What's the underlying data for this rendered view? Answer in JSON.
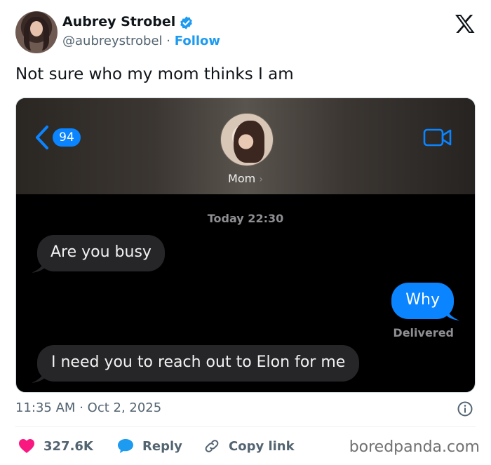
{
  "author": {
    "name": "Aubrey Strobel",
    "handle": "@aubreystrobel",
    "separator": "·",
    "follow_label": "Follow",
    "avatar_icon": "user-avatar",
    "verified_icon": "verified-badge-icon",
    "platform_icon": "x-logo-icon"
  },
  "tweet": {
    "text": "Not sure who my mom thinks I am"
  },
  "screenshot": {
    "back_count": "94",
    "contact_name": "Mom",
    "contact_chevron": "›",
    "timestamp": "Today 22:30",
    "messages": [
      {
        "direction": "incoming",
        "text": "Are you busy"
      },
      {
        "direction": "outgoing",
        "text": "Why"
      },
      {
        "direction": "incoming",
        "text": "I need you to reach out to Elon for me"
      }
    ],
    "delivery_status": "Delivered",
    "colors": {
      "outgoing": "#0a84ff",
      "incoming": "#262629"
    }
  },
  "meta": {
    "time": "11:35 AM",
    "separator": "·",
    "date": "Oct 2, 2025"
  },
  "actions": {
    "likes": "327.6K",
    "reply_label": "Reply",
    "copy_label": "Copy link"
  },
  "watermark": "boredpanda.com",
  "colors": {
    "accent": "#1d9bf0",
    "like": "#f91880",
    "text_secondary": "#536471"
  }
}
